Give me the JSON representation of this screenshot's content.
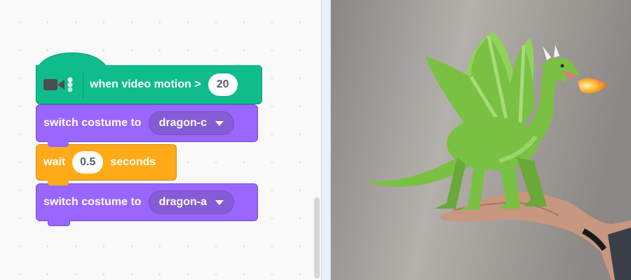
{
  "blocks": {
    "hat": {
      "label": "when video motion >",
      "value": "20",
      "icon": "video-camera-icon",
      "ext_icon": "video-sensing-icon"
    },
    "switch1": {
      "label": "switch costume to",
      "costume": "dragon-c"
    },
    "wait": {
      "label": "wait",
      "value": "0.5",
      "suffix": "seconds"
    },
    "switch2": {
      "label": "switch costume to",
      "costume": "dragon-a"
    }
  },
  "stage": {
    "sprite": "dragon",
    "backdrop": "video-feed-hand"
  },
  "colors": {
    "events_green": "#0fbd8c",
    "looks_purple": "#9966ff",
    "control_orange": "#ffab19",
    "dragon_green": "#7ac143"
  }
}
